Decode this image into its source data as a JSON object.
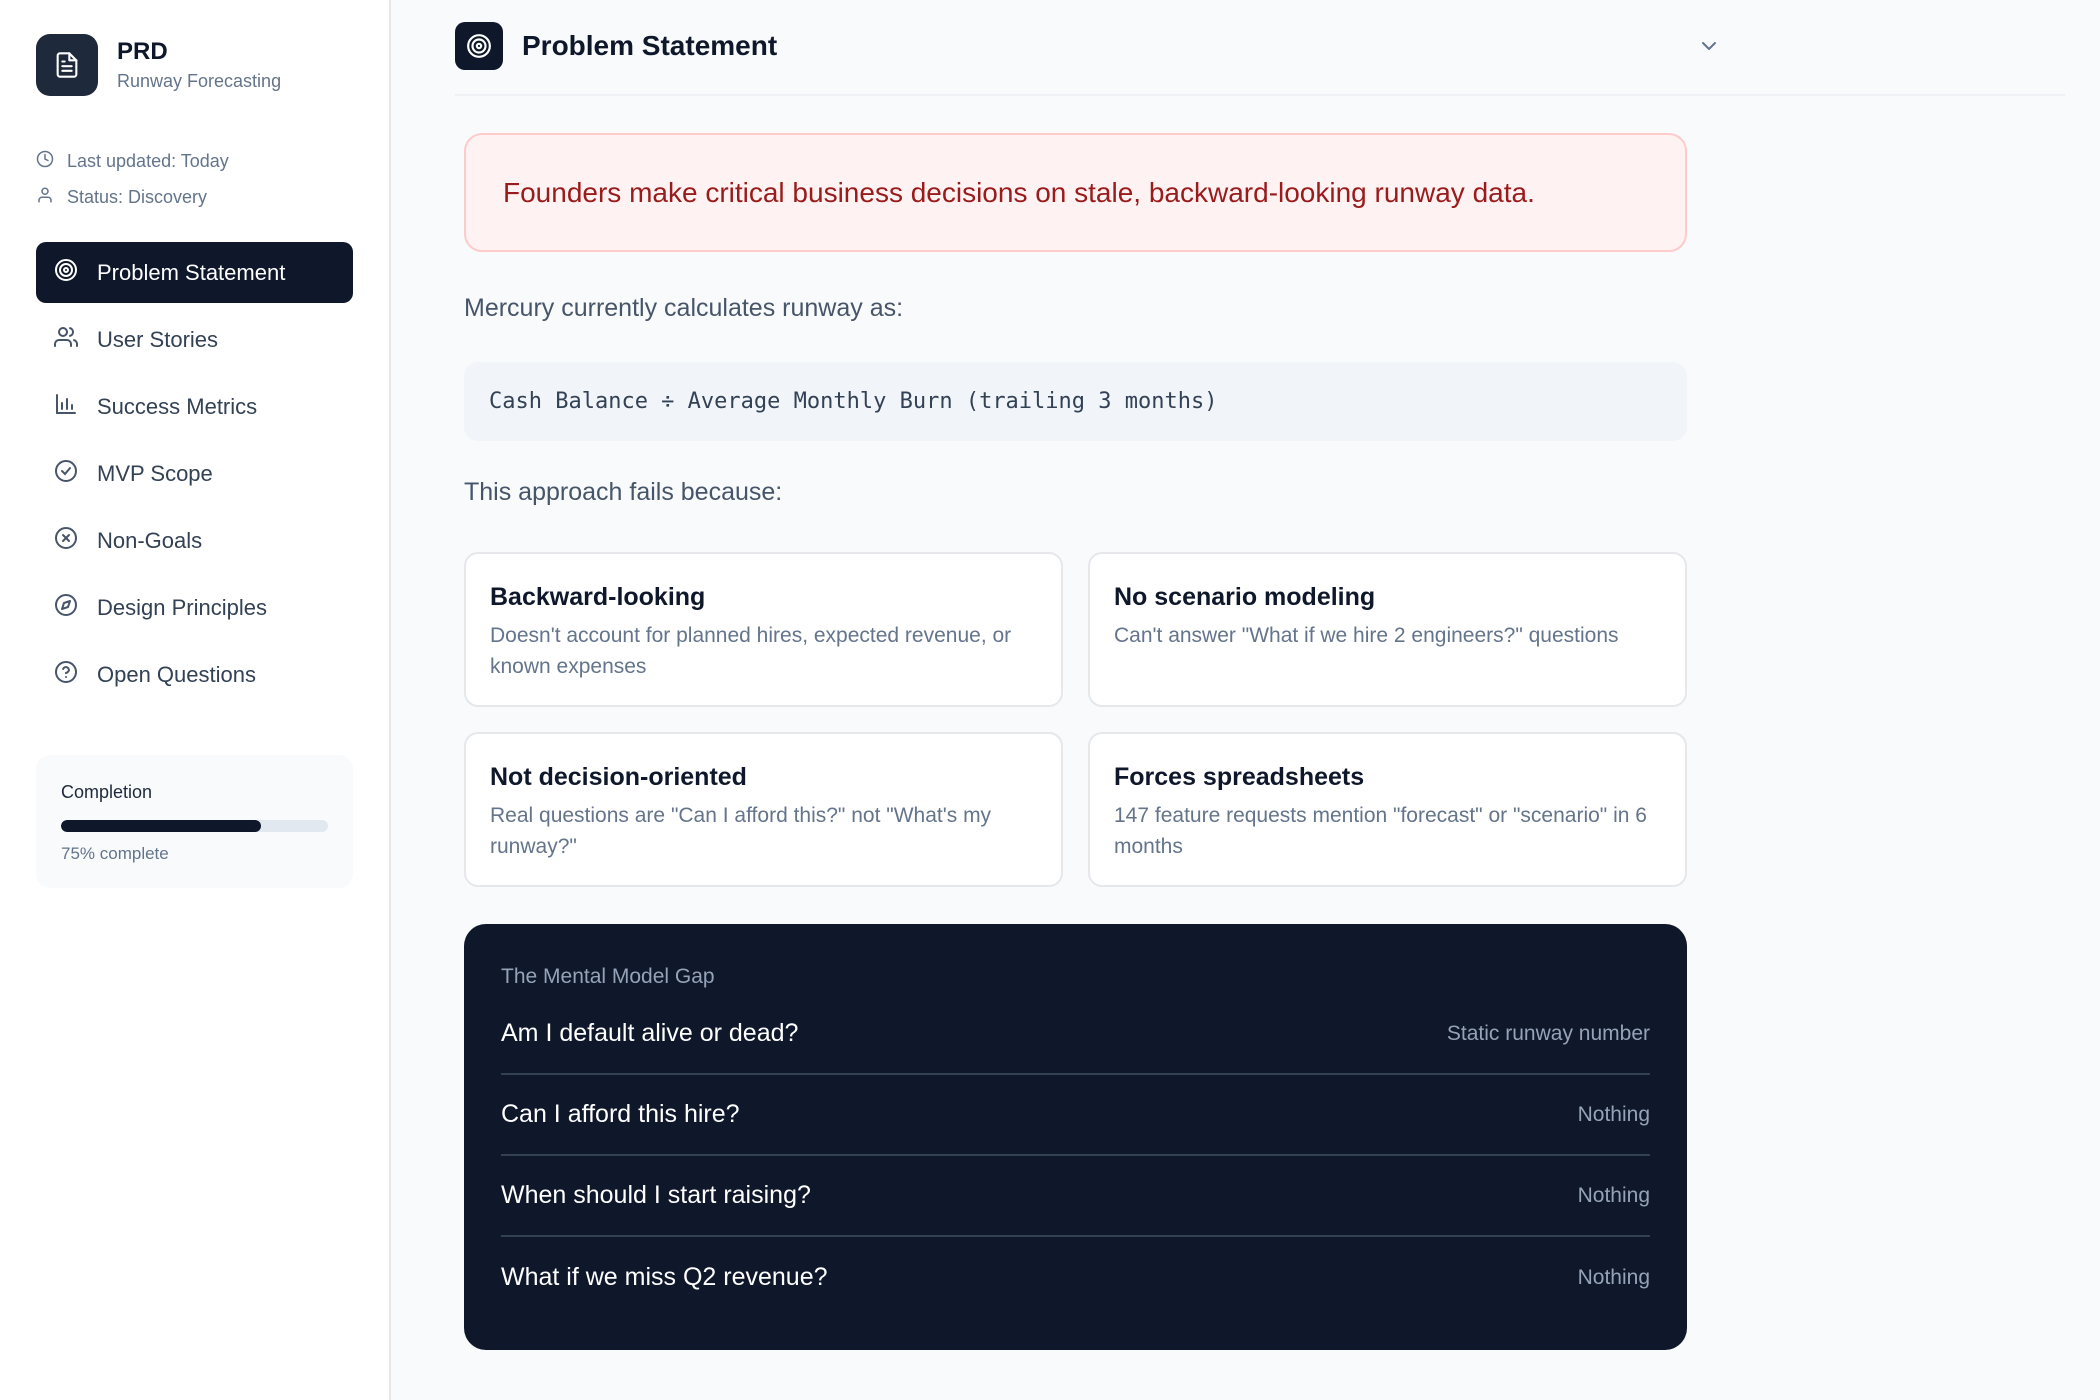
{
  "brand": {
    "title": "PRD",
    "subtitle": "Runway Forecasting",
    "icon": "document-icon"
  },
  "meta": {
    "updated": "Last updated: Today",
    "status": "Status: Discovery"
  },
  "nav": [
    {
      "label": "Problem Statement",
      "icon": "target-icon",
      "active": true
    },
    {
      "label": "User Stories",
      "icon": "users-icon",
      "active": false
    },
    {
      "label": "Success Metrics",
      "icon": "bar-chart-icon",
      "active": false
    },
    {
      "label": "MVP Scope",
      "icon": "check-circle-icon",
      "active": false
    },
    {
      "label": "Non-Goals",
      "icon": "x-circle-icon",
      "active": false
    },
    {
      "label": "Design Principles",
      "icon": "compass-icon",
      "active": false
    },
    {
      "label": "Open Questions",
      "icon": "help-circle-icon",
      "active": false
    }
  ],
  "completion": {
    "label": "Completion",
    "percent": 75,
    "text": "75% complete"
  },
  "section": {
    "title": "Problem Statement"
  },
  "alert": "Founders make critical business decisions on stale, backward-looking runway data.",
  "intro": "Mercury currently calculates runway as:",
  "formula": "Cash Balance ÷ Average Monthly Burn (trailing 3 months)",
  "fails_heading": "This approach fails because:",
  "cards": [
    {
      "title": "Backward-looking",
      "body": "Doesn't account for planned hires, expected revenue, or known expenses"
    },
    {
      "title": "No scenario modeling",
      "body": "Can't answer \"What if we hire 2 engineers?\" questions"
    },
    {
      "title": "Not decision-oriented",
      "body": "Real questions are \"Can I afford this?\" not \"What's my runway?\""
    },
    {
      "title": "Forces spreadsheets",
      "body": "147 feature requests mention \"forecast\" or \"scenario\" in 6 months"
    }
  ],
  "gap": {
    "title": "The Mental Model Gap",
    "rows": [
      {
        "question": "Am I default alive or dead?",
        "answer": "Static runway number"
      },
      {
        "question": "Can I afford this hire?",
        "answer": "Nothing"
      },
      {
        "question": "When should I start raising?",
        "answer": "Nothing"
      },
      {
        "question": "What if we miss Q2 revenue?",
        "answer": "Nothing"
      }
    ]
  }
}
